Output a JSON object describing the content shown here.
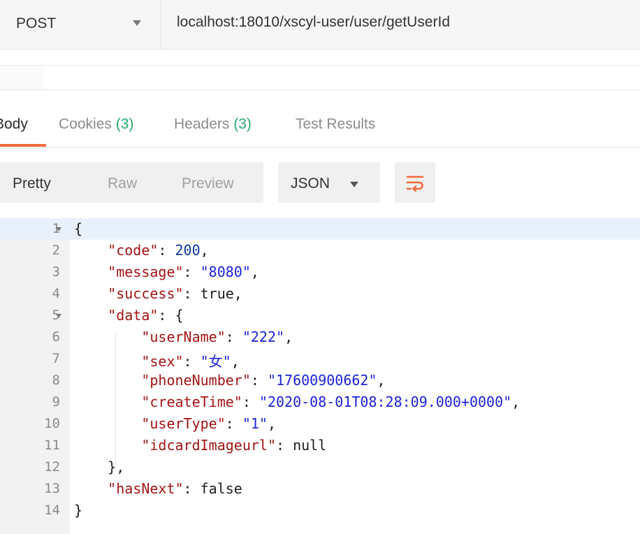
{
  "request": {
    "method": "POST",
    "url": "localhost:18010/xscyl-user/user/getUserId"
  },
  "tabs": [
    {
      "label": "Body",
      "count": ""
    },
    {
      "label": "Cookies",
      "count": "(3)"
    },
    {
      "label": "Headers",
      "count": "(3)"
    },
    {
      "label": "Test Results",
      "count": ""
    }
  ],
  "view_modes": [
    "Pretty",
    "Raw",
    "Preview"
  ],
  "format": "JSON",
  "colors": {
    "accent": "#f26b3a",
    "count": "#26a76b",
    "key": "#a31515",
    "string": "#1c23d6"
  },
  "wrap_icon": "wrap-lines-icon",
  "code_lines": [
    {
      "n": "1",
      "parts": [
        [
          "p",
          "{"
        ]
      ]
    },
    {
      "n": "2",
      "parts": [
        [
          "p",
          "    "
        ],
        [
          "k",
          "\"code\""
        ],
        [
          "p",
          ": "
        ],
        [
          "n",
          "200"
        ],
        [
          "p",
          ","
        ]
      ]
    },
    {
      "n": "3",
      "parts": [
        [
          "p",
          "    "
        ],
        [
          "k",
          "\"message\""
        ],
        [
          "p",
          ": "
        ],
        [
          "s",
          "\"8080\""
        ],
        [
          "p",
          ","
        ]
      ]
    },
    {
      "n": "4",
      "parts": [
        [
          "p",
          "    "
        ],
        [
          "k",
          "\"success\""
        ],
        [
          "p",
          ": true,"
        ]
      ]
    },
    {
      "n": "5",
      "parts": [
        [
          "p",
          "    "
        ],
        [
          "k",
          "\"data\""
        ],
        [
          "p",
          ": {"
        ]
      ]
    },
    {
      "n": "6",
      "parts": [
        [
          "p",
          "        "
        ],
        [
          "k",
          "\"userName\""
        ],
        [
          "p",
          ": "
        ],
        [
          "s",
          "\"222\""
        ],
        [
          "p",
          ","
        ]
      ]
    },
    {
      "n": "7",
      "parts": [
        [
          "p",
          "        "
        ],
        [
          "k",
          "\"sex\""
        ],
        [
          "p",
          ": "
        ],
        [
          "s",
          "\"女\""
        ],
        [
          "p",
          ","
        ]
      ]
    },
    {
      "n": "8",
      "parts": [
        [
          "p",
          "        "
        ],
        [
          "k",
          "\"phoneNumber\""
        ],
        [
          "p",
          ": "
        ],
        [
          "s",
          "\"17600900662\""
        ],
        [
          "p",
          ","
        ]
      ]
    },
    {
      "n": "9",
      "parts": [
        [
          "p",
          "        "
        ],
        [
          "k",
          "\"createTime\""
        ],
        [
          "p",
          ": "
        ],
        [
          "s",
          "\"2020-08-01T08:28:09.000+0000\""
        ],
        [
          "p",
          ","
        ]
      ]
    },
    {
      "n": "10",
      "parts": [
        [
          "p",
          "        "
        ],
        [
          "k",
          "\"userType\""
        ],
        [
          "p",
          ": "
        ],
        [
          "s",
          "\"1\""
        ],
        [
          "p",
          ","
        ]
      ]
    },
    {
      "n": "11",
      "parts": [
        [
          "p",
          "        "
        ],
        [
          "k",
          "\"idcardImageurl\""
        ],
        [
          "p",
          ": null"
        ]
      ]
    },
    {
      "n": "12",
      "parts": [
        [
          "p",
          "    },"
        ]
      ]
    },
    {
      "n": "13",
      "parts": [
        [
          "p",
          "    "
        ],
        [
          "k",
          "\"hasNext\""
        ],
        [
          "p",
          ": false"
        ]
      ]
    },
    {
      "n": "14",
      "parts": [
        [
          "p",
          "}"
        ]
      ]
    }
  ]
}
